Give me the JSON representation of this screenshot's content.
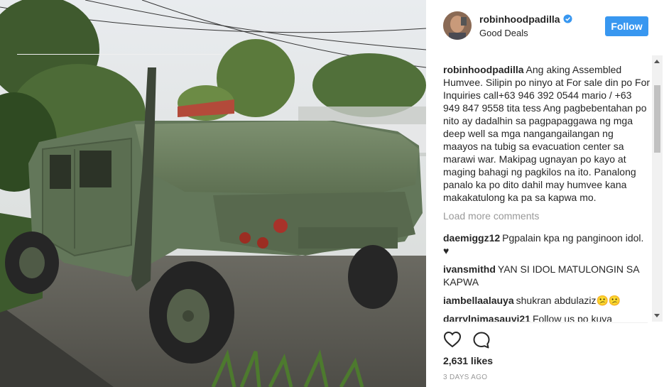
{
  "post": {
    "username": "robinhoodpadilla",
    "location": "Good Deals",
    "follow_label": "Follow",
    "photo_description": "Green military Humvee parked outdoors",
    "caption": {
      "username": "robinhoodpadilla",
      "text": "Ang aking Assembled Humvee. Silipin po ninyo at For sale din po For Inquiries call+63 946 392 0544 mario / +63 949 847 9558 tita tess Ang pagbebentahan po nito ay dadalhin sa pagpapaggawa ng mga deep well sa mga nangangailangan ng maayos na tubig sa evacuation center sa marawi war. Makipag ugnayan po kayo at maging bahagi ng pagkilos na ito. Panalong panalo ka po dito dahil may humvee kana makakatulong ka pa sa kapwa mo."
    },
    "load_more_label": "Load more comments",
    "comments": [
      {
        "username": "daemiggz12",
        "text": "Pgpalain kpa ng panginoon idol. ♥"
      },
      {
        "username": "ivansmithd",
        "text": "YAN SI IDOL MATULONGIN SA KAPWA"
      },
      {
        "username": "iambellaalauya",
        "text": "shukran abdulaziz😕😕"
      },
      {
        "username": "darrylnimasauyi21",
        "text": "Follow us po kuya"
      }
    ],
    "likes": "2,631 likes",
    "timestamp": "3 DAYS AGO"
  },
  "icons": {
    "verified": "verified-badge-icon",
    "like": "heart-icon",
    "comment": "comment-bubble-icon"
  },
  "colors": {
    "follow_button": "#3897f0",
    "verified": "#3897f0",
    "muted_text": "#999999",
    "vehicle": "#6b7f5e"
  }
}
